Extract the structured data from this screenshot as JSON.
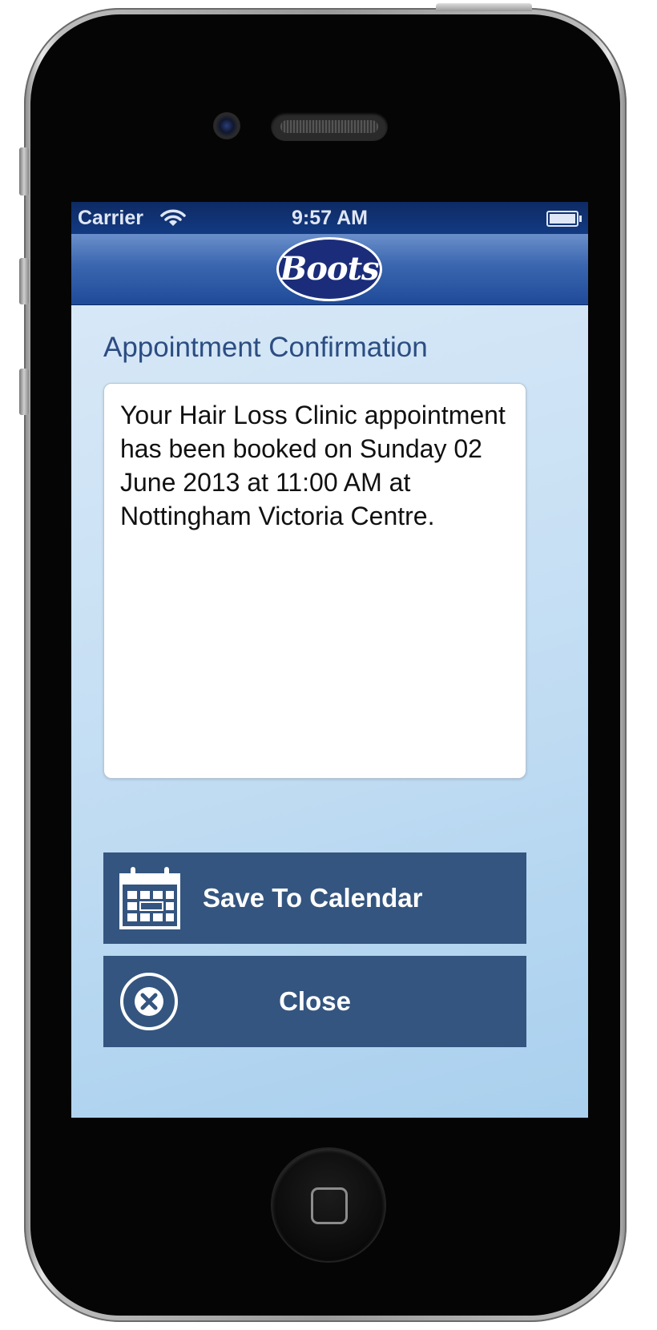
{
  "status_bar": {
    "carrier": "Carrier",
    "time": "9:57 AM"
  },
  "nav": {
    "logo_text": "Boots"
  },
  "page": {
    "title": "Appointment Confirmation",
    "message": "Your Hair Loss Clinic appointment has been booked on Sunday 02 June 2013 at 11:00 AM at Nottingham Victoria Centre."
  },
  "buttons": {
    "save_label": "Save To Calendar",
    "save_icon": "calendar-icon",
    "close_label": "Close",
    "close_icon": "close-circle-icon"
  },
  "colors": {
    "brand_navy": "#1b2d7a",
    "button_fill": "#34557f",
    "title_text": "#2c4d82",
    "screen_bg": "#c8e0f4"
  }
}
